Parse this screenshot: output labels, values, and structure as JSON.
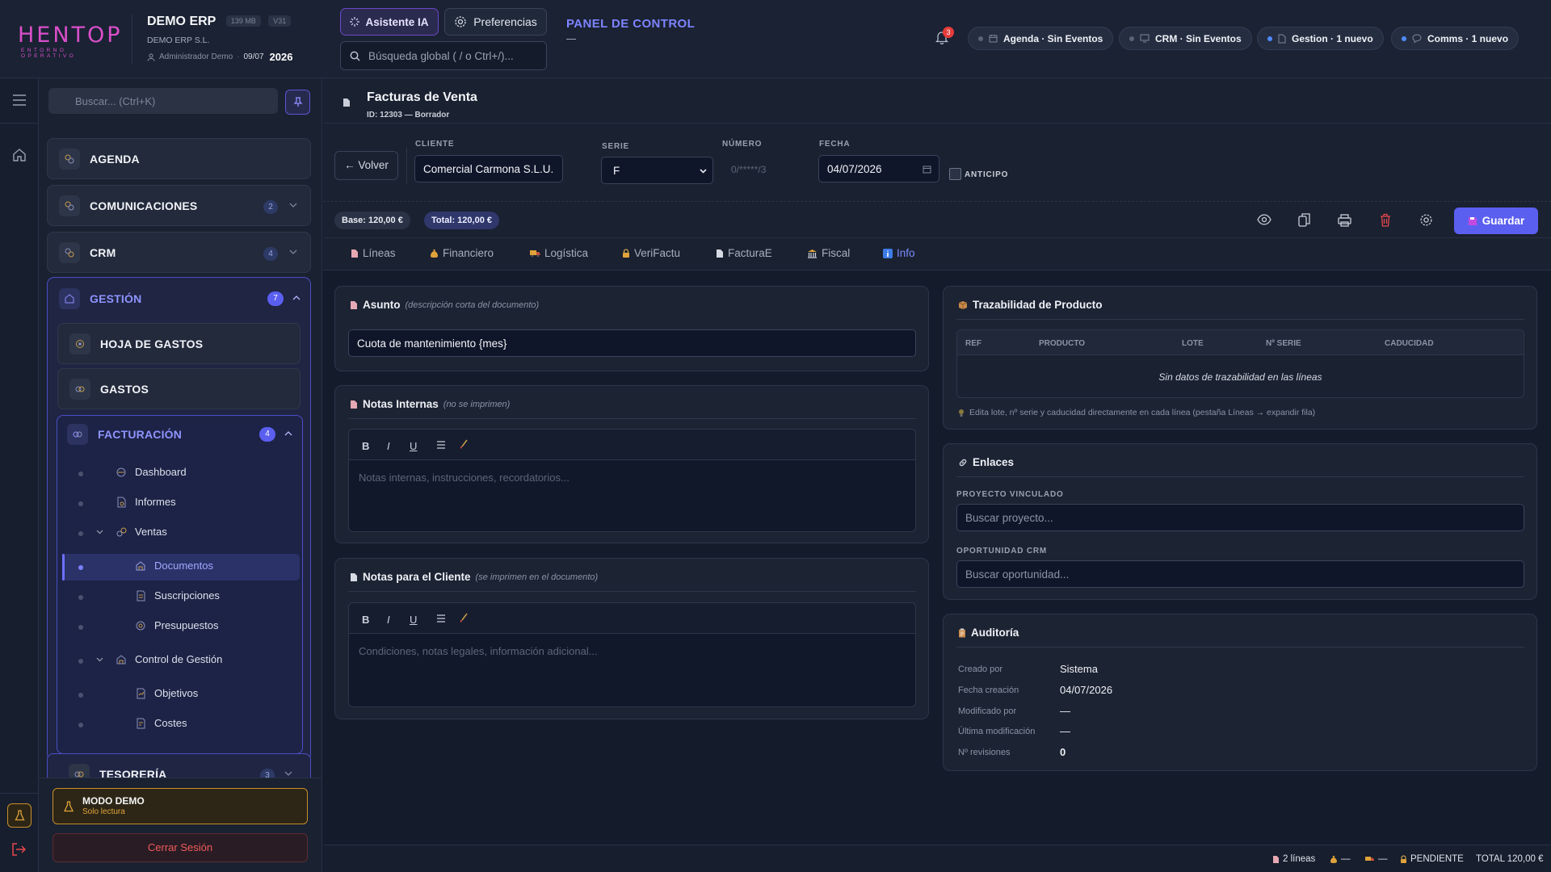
{
  "brand": {
    "logo_text": "HENTOP",
    "logo_sub": "ENTORNO OPERATIVO",
    "logo_color": "#d94fc9"
  },
  "company": {
    "name": "DEMO ERP",
    "size_badge": "139 MB",
    "version_badge": "V31",
    "legal_name": "DEMO ERP S.L.",
    "user": "Administrador Demo",
    "date_short": "09/07",
    "year": "2026"
  },
  "topbar": {
    "ai_button": "Asistente IA",
    "prefs_button": "Preferencias",
    "search_placeholder": "Búsqueda global ( / o Ctrl+/)...",
    "panel_title": "PANEL DE CONTROL",
    "bell_count": "3",
    "pills": [
      {
        "icon": "calendar-icon",
        "label": "Agenda · Sin Eventos",
        "dot": "gray"
      },
      {
        "icon": "crm-icon",
        "label": "CRM · Sin Eventos",
        "dot": "gray"
      },
      {
        "icon": "document-icon",
        "label": "Gestion · 1 nuevo",
        "dot": "blue"
      },
      {
        "icon": "chat-icon",
        "label": "Comms · 1 nuevo",
        "dot": "blue"
      }
    ]
  },
  "sidebar": {
    "search_placeholder": "Buscar... (Ctrl+K)",
    "items": [
      {
        "label": "AGENDA"
      },
      {
        "label": "COMUNICACIONES",
        "count": "2"
      },
      {
        "label": "CRM",
        "count": "4"
      }
    ],
    "gestion": {
      "label": "GESTIÓN",
      "count": "7",
      "children": [
        {
          "label": "HOJA DE GASTOS"
        },
        {
          "label": "GASTOS"
        }
      ],
      "facturacion": {
        "label": "FACTURACIÓN",
        "count": "4",
        "tree": [
          {
            "label": "Dashboard"
          },
          {
            "label": "Informes"
          },
          {
            "label": "Ventas"
          },
          {
            "label": "Documentos",
            "active": true
          },
          {
            "label": "Suscripciones"
          },
          {
            "label": "Presupuestos"
          },
          {
            "label": "Control de Gestión"
          },
          {
            "label": "Objetivos"
          },
          {
            "label": "Costes"
          }
        ]
      }
    },
    "tesoreria": {
      "label": "TESORERÍA",
      "count": "3"
    },
    "demo": {
      "title": "MODO DEMO",
      "subtitle": "Solo lectura"
    },
    "logout": "Cerrar Sesión"
  },
  "document": {
    "title": "Facturas de Venta",
    "id_line": "ID: 12303 — Borrador",
    "back_button": "← Volver",
    "fields": {
      "cliente_label": "CLIENTE",
      "cliente_value": "Comercial Carmona S.L.U.",
      "serie_label": "SERIE",
      "serie_value": "F",
      "numero_label": "NÚMERO",
      "numero_value": "0/*****/3",
      "fecha_label": "FECHA",
      "fecha_value": "04/07/2026",
      "anticipo_label": "ANTICIPO"
    },
    "base": "Base: 120,00 €",
    "total": "Total: 120,00 €",
    "save_button": "Guardar",
    "tabs": [
      {
        "label": "Líneas",
        "icon": "document-icon"
      },
      {
        "label": "Financiero",
        "icon": "money-bag-icon"
      },
      {
        "label": "Logística",
        "icon": "truck-icon"
      },
      {
        "label": "VeriFactu",
        "icon": "lock-icon"
      },
      {
        "label": "FacturaE",
        "icon": "document-icon"
      },
      {
        "label": "Fiscal",
        "icon": "bank-icon"
      },
      {
        "label": "Info",
        "icon": "info-icon",
        "active": true
      }
    ]
  },
  "info": {
    "asunto": {
      "title": "Asunto",
      "hint": "(descripción corta del documento)",
      "value": "Cuota de mantenimiento {mes}"
    },
    "notas_internas": {
      "title": "Notas Internas",
      "hint": "(no se imprimen)",
      "placeholder": "Notas internas, instrucciones, recordatorios..."
    },
    "notas_cliente": {
      "title": "Notas para el Cliente",
      "hint": "(se imprimen en el documento)",
      "placeholder": "Condiciones, notas legales, información adicional..."
    },
    "editor_tools": [
      "B",
      "I",
      "U"
    ],
    "trazabilidad": {
      "title": "Trazabilidad de Producto",
      "columns": [
        "REF",
        "PRODUCTO",
        "LOTE",
        "Nº SERIE",
        "CADUCIDAD"
      ],
      "empty": "Sin datos de trazabilidad en las líneas",
      "tip": "Edita lote, nº serie y caducidad directamente en cada línea (pestaña Líneas → expandir fila)"
    },
    "enlaces": {
      "title": "Enlaces",
      "proyecto_label": "PROYECTO VINCULADO",
      "proyecto_placeholder": "Buscar proyecto...",
      "oportunidad_label": "OPORTUNIDAD CRM",
      "oportunidad_placeholder": "Buscar oportunidad..."
    },
    "auditoria": {
      "title": "Auditoría",
      "rows": [
        {
          "k": "Creado por",
          "v": "Sistema"
        },
        {
          "k": "Fecha creación",
          "v": "04/07/2026"
        },
        {
          "k": "Modificado por",
          "v": "—"
        },
        {
          "k": "Última modificación",
          "v": "—"
        },
        {
          "k": "Nº revisiones",
          "v": "0"
        }
      ]
    }
  },
  "footer": {
    "lineas": "2 líneas",
    "financiero": "—",
    "logistica": "—",
    "estado": "PENDIENTE",
    "total": "TOTAL 120,00 €"
  },
  "colors": {
    "accent": "#5b5ff0",
    "accent_text": "#7e84ff",
    "danger": "#e5484d",
    "warning": "#c98f2a"
  }
}
